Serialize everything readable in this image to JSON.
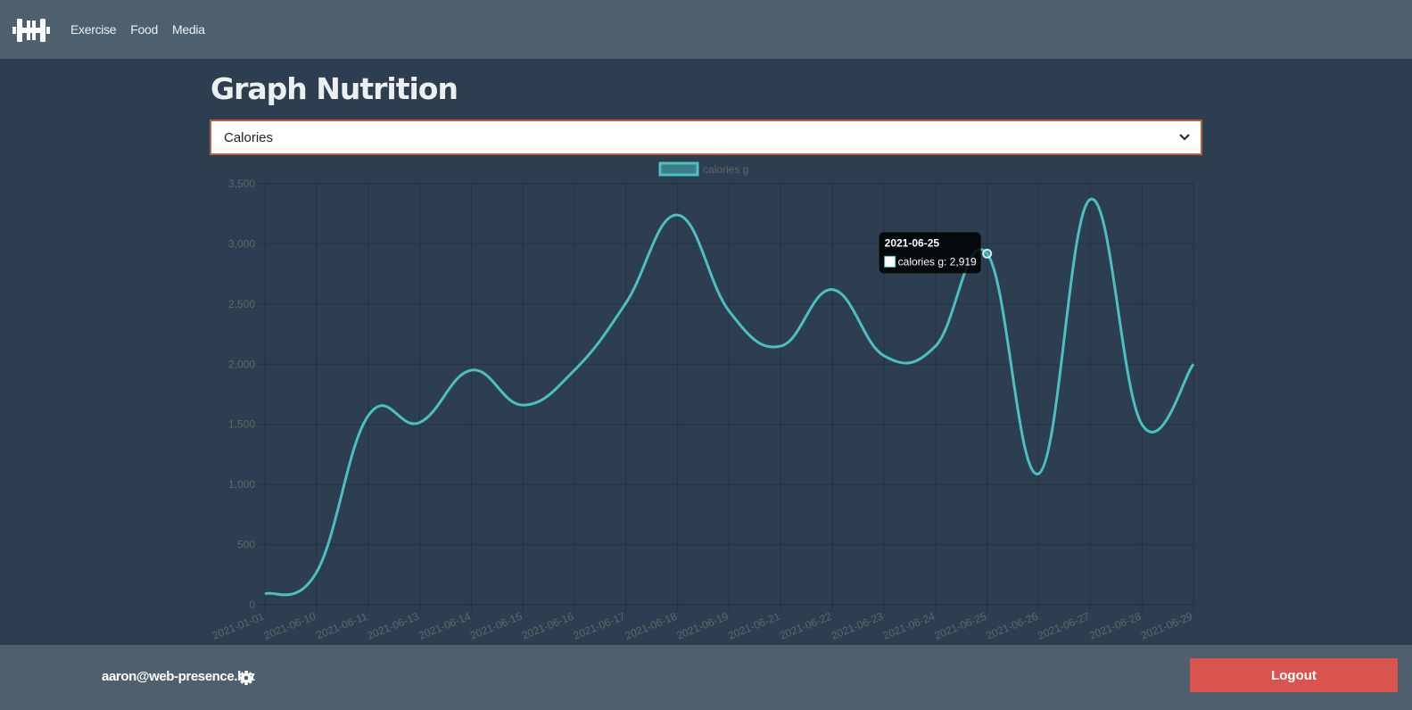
{
  "nav": {
    "logo_icon": "dumbbell-icon",
    "links": [
      "Exercise",
      "Food",
      "Media"
    ]
  },
  "page": {
    "title": "Graph Nutrition"
  },
  "metric_select": {
    "value": "Calories",
    "options": [
      "Calories"
    ]
  },
  "colors": {
    "topbar": "#4e5f6e",
    "background": "#2c3e50",
    "series_line": "#4bc0c0",
    "logout_button": "#d9534f",
    "select_border": "#b3623a"
  },
  "chart_data": {
    "type": "line",
    "legend": "calories g",
    "legend_position": "top",
    "grid": true,
    "ylim": [
      0,
      3500
    ],
    "yticks": [
      "0",
      "500",
      "1,000",
      "1,500",
      "2,000",
      "2,500",
      "3,000",
      "3,500"
    ],
    "x": [
      "2021-01-01",
      "2021-06-10",
      "2021-06-11",
      "2021-06-13",
      "2021-06-14",
      "2021-06-15",
      "2021-06-16",
      "2021-06-17",
      "2021-06-18",
      "2021-06-19",
      "2021-06-21",
      "2021-06-22",
      "2021-06-23",
      "2021-06-24",
      "2021-06-25",
      "2021-06-26",
      "2021-06-27",
      "2021-06-28",
      "2021-06-29"
    ],
    "series": [
      {
        "name": "calories g",
        "values": [
          90,
          270,
          1570,
          1515,
          1950,
          1660,
          1950,
          2510,
          3240,
          2440,
          2150,
          2620,
          2070,
          2150,
          2919,
          1090,
          3370,
          1500,
          2000
        ]
      }
    ],
    "tooltip": {
      "title": "2021-06-25",
      "label": "calories g: 2,919",
      "index": 14
    }
  },
  "footer": {
    "email": "aaron@web-presence.biz",
    "settings_icon": "gear-icon",
    "logout_label": "Logout"
  }
}
